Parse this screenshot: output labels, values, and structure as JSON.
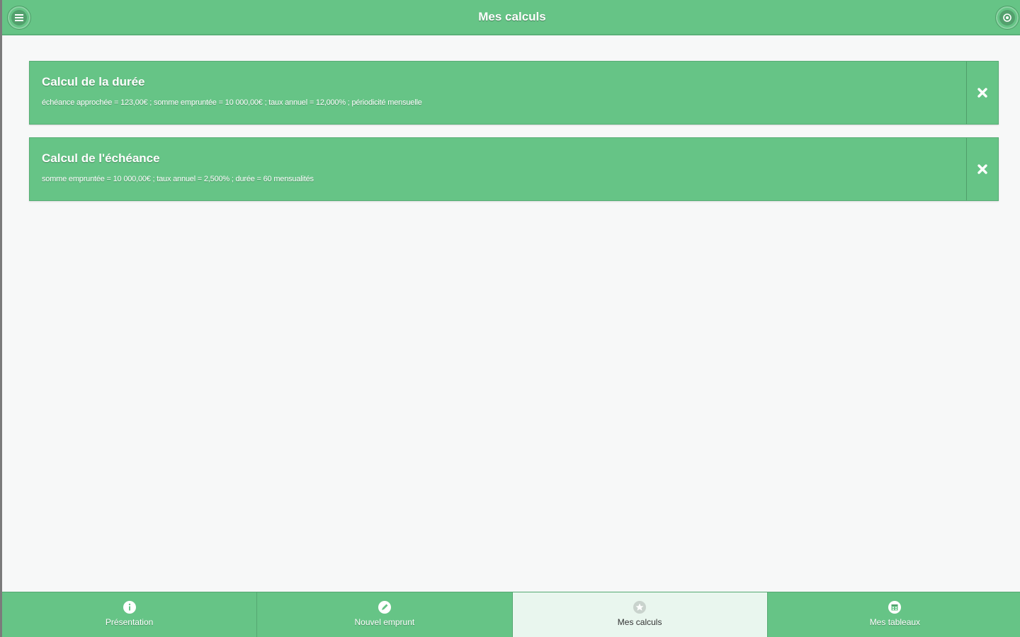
{
  "header": {
    "title": "Mes calculs",
    "menu_icon": "menu-icon",
    "right_icon": "circle-dot-icon"
  },
  "calculs": [
    {
      "title": "Calcul de la durée",
      "description": "échéance approchée = 123,00€ ; somme empruntée = 10 000,00€ ; taux annuel = 12,000% ; périodicité mensuelle",
      "delete_icon": "delete-icon"
    },
    {
      "title": "Calcul de l'échéance",
      "description": "somme empruntée = 10 000,00€ ; taux annuel = 2,500% ; durée = 60 mensualités",
      "delete_icon": "delete-icon"
    }
  ],
  "tabbar": {
    "tabs": [
      {
        "label": "Présentation",
        "icon": "info-icon",
        "active": false
      },
      {
        "label": "Nouvel emprunt",
        "icon": "pencil-icon",
        "active": false
      },
      {
        "label": "Mes calculs",
        "icon": "star-icon",
        "active": true
      },
      {
        "label": "Mes tableaux",
        "icon": "calendar-icon",
        "active": false
      }
    ]
  },
  "colors": {
    "primary_green": "#66c486",
    "background": "#f7f8f8",
    "active_tab": "#e9f6ee"
  }
}
